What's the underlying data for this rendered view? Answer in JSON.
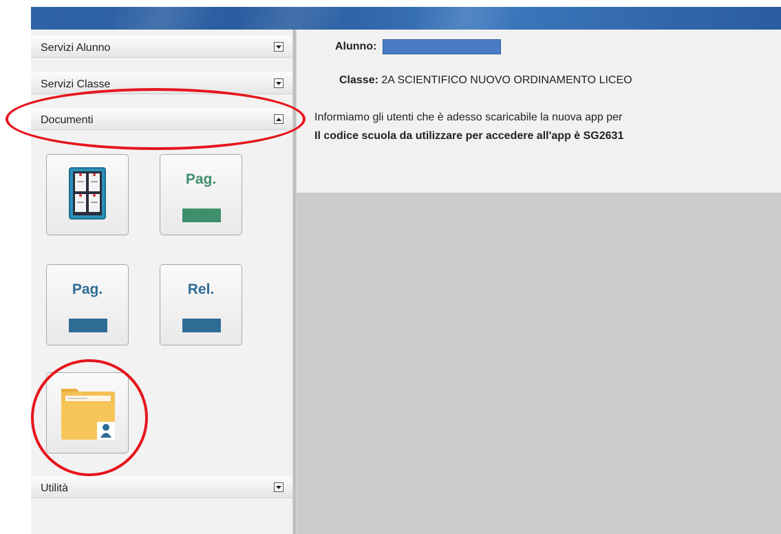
{
  "sidebar": {
    "sections": [
      {
        "label": "Servizi Alunno",
        "state": "collapsed"
      },
      {
        "label": "Servizi Classe",
        "state": "collapsed"
      },
      {
        "label": "Documenti",
        "state": "expanded"
      },
      {
        "label": "Utilità",
        "state": "collapsed"
      }
    ],
    "documenti_buttons": [
      {
        "title": "",
        "icon": "bulletin-board-icon"
      },
      {
        "title": "Pag.",
        "icon": "green-bar-icon",
        "color": "#3f8f6d"
      },
      {
        "title": "Pag.",
        "icon": "blue-bar-icon",
        "color": "#2f6c95"
      },
      {
        "title": "Rel.",
        "icon": "blue-bar-icon",
        "color": "#2f6c95"
      },
      {
        "title": "",
        "icon": "user-folder-icon"
      }
    ]
  },
  "main": {
    "student_label": "Alunno:",
    "class_label": "Classe:",
    "class_value": "2A SCIENTIFICO NUOVO ORDINAMENTO LICEO",
    "notice_line1": "Informiamo gli utenti che è adesso scaricabile la nuova app per",
    "notice_line2": "Il codice scuola da utilizzare per accedere all'app è SG2631"
  },
  "colors": {
    "banner": "#2e63a6",
    "annotation": "#e6141b",
    "redacted_name": "#4a7cc6"
  }
}
